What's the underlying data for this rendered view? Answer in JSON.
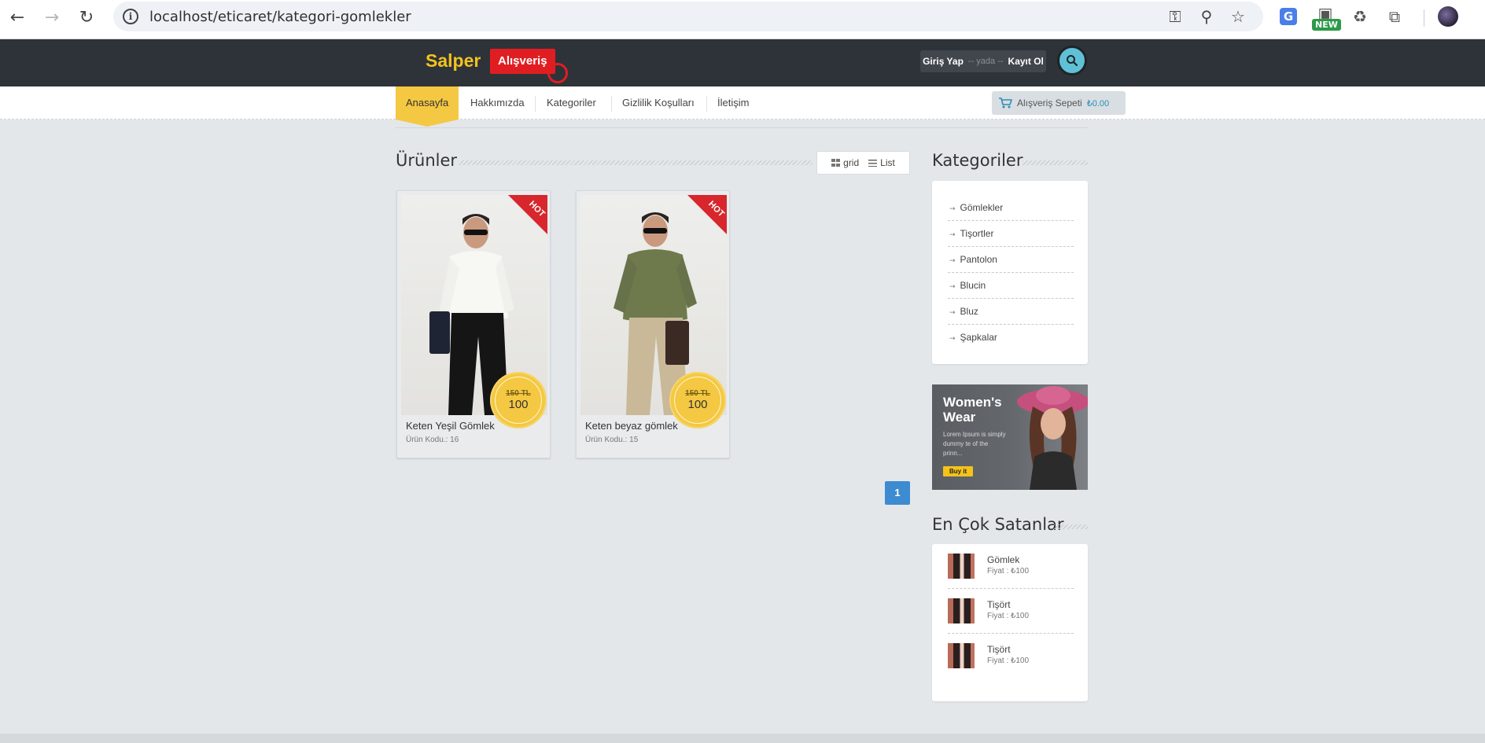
{
  "browser": {
    "url": "localhost/eticaret/kategori-gomlekler",
    "new_badge": "NEW"
  },
  "header": {
    "logo_text": "Salper",
    "logo_tag": "Alışveriş",
    "login": "Giriş Yap",
    "or": "-- yada --",
    "register": "Kayıt Ol"
  },
  "nav": {
    "items": [
      "Anasayfa",
      "Hakkımızda",
      "Kategoriler",
      "Gizlilik Koşulları",
      "İletişim"
    ],
    "cart_label": "Alışveriş Sepeti",
    "cart_amount": "₺0.00"
  },
  "products": {
    "title": "Ürünler",
    "view_grid": "grid",
    "view_list": "List",
    "items": [
      {
        "name": "Keten Yeşil Gömlek",
        "code": "Ürün Kodu.: 16",
        "old_price": "150 TL",
        "price": "100",
        "badge": "HOT"
      },
      {
        "name": "Keten beyaz gömlek",
        "code": "Ürün Kodu.: 15",
        "old_price": "150 TL",
        "price": "100",
        "badge": "HOT"
      }
    ],
    "page": "1"
  },
  "sidebar": {
    "categories_title": "Kategoriler",
    "categories": [
      "Gömlekler",
      "Tişortler",
      "Pantolon",
      "Blucin",
      "Bluz",
      "Şapkalar"
    ],
    "promo": {
      "title": "Women's Wear",
      "desc": "Lorem Ipsum is simply dummy te of the prinn...",
      "button": "Buy it"
    },
    "bestsellers_title": "En Çok Satanlar",
    "bestsellers": [
      {
        "name": "Gömlek",
        "price": "Fiyat : ₺100"
      },
      {
        "name": "Tişört",
        "price": "Fiyat : ₺100"
      },
      {
        "name": "Tişört",
        "price": "Fiyat : ₺100"
      }
    ]
  }
}
